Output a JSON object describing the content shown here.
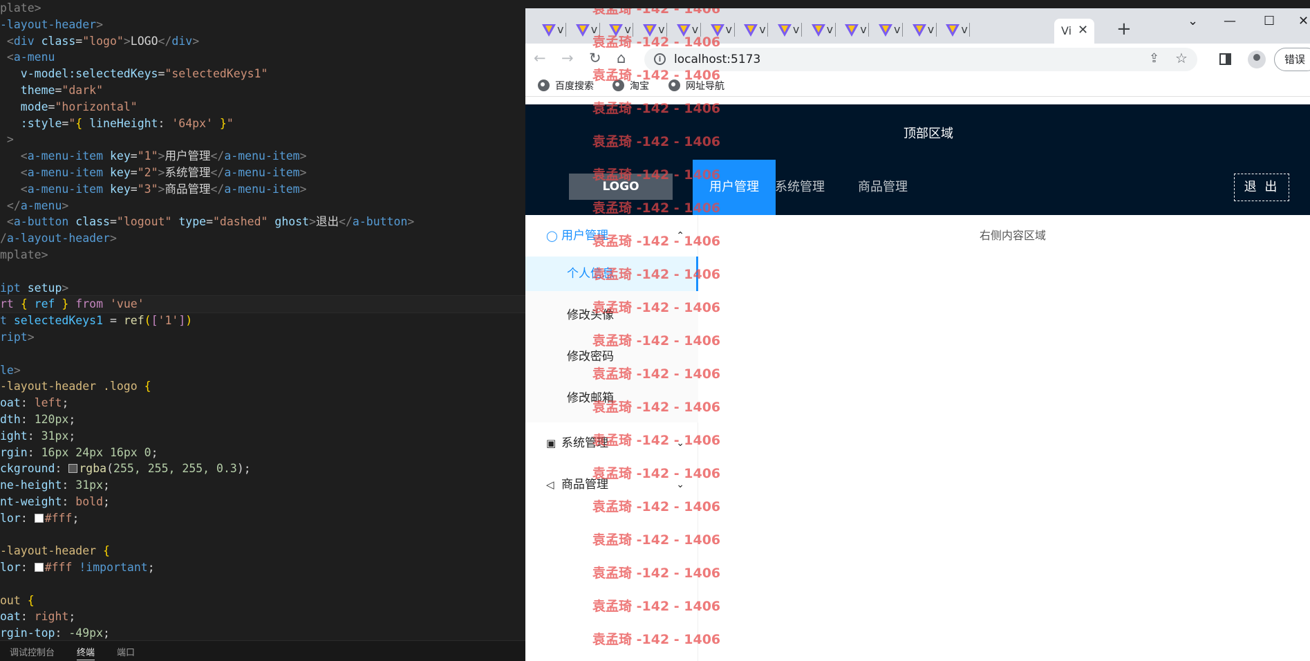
{
  "editor": {
    "lines": [
      [
        [
          "t-punc",
          "plate>"
        ]
      ],
      [
        [
          "t-tag",
          "-layout-header"
        ],
        [
          "t-punc",
          ">"
        ]
      ],
      [
        [
          "t-punc",
          " <"
        ],
        [
          "t-tag",
          "div"
        ],
        [
          "t-attr",
          " class"
        ],
        [
          "t-txt",
          "="
        ],
        [
          "t-str",
          "\"logo\""
        ],
        [
          "t-punc",
          ">"
        ],
        [
          "t-txt",
          "LOGO"
        ],
        [
          "t-punc",
          "</"
        ],
        [
          "t-tag",
          "div"
        ],
        [
          "t-punc",
          ">"
        ]
      ],
      [
        [
          "t-punc",
          " <"
        ],
        [
          "t-tag",
          "a-menu"
        ]
      ],
      [
        [
          "t-attr",
          "   v-model:selectedKeys"
        ],
        [
          "t-txt",
          "="
        ],
        [
          "t-str",
          "\"selectedKeys1\""
        ]
      ],
      [
        [
          "t-attr",
          "   theme"
        ],
        [
          "t-txt",
          "="
        ],
        [
          "t-str",
          "\"dark\""
        ]
      ],
      [
        [
          "t-attr",
          "   mode"
        ],
        [
          "t-txt",
          "="
        ],
        [
          "t-str",
          "\"horizontal\""
        ]
      ],
      [
        [
          "t-attr",
          "   :style"
        ],
        [
          "t-txt",
          "="
        ],
        [
          "t-str",
          "\""
        ],
        [
          "t-brk",
          "{"
        ],
        [
          "t-attr",
          " lineHeight"
        ],
        [
          "t-txt",
          ": "
        ],
        [
          "t-str",
          "'64px'"
        ],
        [
          "t-brk",
          " }"
        ],
        [
          "t-str",
          "\""
        ]
      ],
      [
        [
          "t-punc",
          " >"
        ]
      ],
      [
        [
          "t-punc",
          "   <"
        ],
        [
          "t-tag",
          "a-menu-item"
        ],
        [
          "t-attr",
          " key"
        ],
        [
          "t-txt",
          "="
        ],
        [
          "t-str",
          "\"1\""
        ],
        [
          "t-punc",
          ">"
        ],
        [
          "t-txt",
          "用户管理"
        ],
        [
          "t-punc",
          "</"
        ],
        [
          "t-tag",
          "a-menu-item"
        ],
        [
          "t-punc",
          ">"
        ]
      ],
      [
        [
          "t-punc",
          "   <"
        ],
        [
          "t-tag",
          "a-menu-item"
        ],
        [
          "t-attr",
          " key"
        ],
        [
          "t-txt",
          "="
        ],
        [
          "t-str",
          "\"2\""
        ],
        [
          "t-punc",
          ">"
        ],
        [
          "t-txt",
          "系统管理"
        ],
        [
          "t-punc",
          "</"
        ],
        [
          "t-tag",
          "a-menu-item"
        ],
        [
          "t-punc",
          ">"
        ]
      ],
      [
        [
          "t-punc",
          "   <"
        ],
        [
          "t-tag",
          "a-menu-item"
        ],
        [
          "t-attr",
          " key"
        ],
        [
          "t-txt",
          "="
        ],
        [
          "t-str",
          "\"3\""
        ],
        [
          "t-punc",
          ">"
        ],
        [
          "t-txt",
          "商品管理"
        ],
        [
          "t-punc",
          "</"
        ],
        [
          "t-tag",
          "a-menu-item"
        ],
        [
          "t-punc",
          ">"
        ]
      ],
      [
        [
          "t-punc",
          " </"
        ],
        [
          "t-tag",
          "a-menu"
        ],
        [
          "t-punc",
          ">"
        ]
      ],
      [
        [
          "t-punc",
          " <"
        ],
        [
          "t-tag",
          "a-button"
        ],
        [
          "t-attr",
          " class"
        ],
        [
          "t-txt",
          "="
        ],
        [
          "t-str",
          "\"logout\""
        ],
        [
          "t-attr",
          " type"
        ],
        [
          "t-txt",
          "="
        ],
        [
          "t-str",
          "\"dashed\""
        ],
        [
          "t-attr",
          " ghost"
        ],
        [
          "t-punc",
          ">"
        ],
        [
          "t-txt",
          "退出"
        ],
        [
          "t-punc",
          "</"
        ],
        [
          "t-tag",
          "a-button"
        ],
        [
          "t-punc",
          ">"
        ]
      ],
      [
        [
          "t-punc",
          "/"
        ],
        [
          "t-tag",
          "a-layout-header"
        ],
        [
          "t-punc",
          ">"
        ]
      ],
      [
        [
          "t-punc",
          "mplate>"
        ]
      ],
      [],
      [
        [
          "t-tag",
          "ipt"
        ],
        [
          "t-attr",
          " setup"
        ],
        [
          "t-punc",
          ">"
        ]
      ],
      [
        [
          "t-kw",
          "rt"
        ],
        [
          "t-txt",
          " "
        ],
        [
          "t-brk",
          "{"
        ],
        [
          "t-var",
          " ref "
        ],
        [
          "t-brk",
          "}"
        ],
        [
          "t-kw",
          " from"
        ],
        [
          "t-str",
          " 'vue'"
        ]
      ],
      [
        [
          "t-tag",
          "t"
        ],
        [
          "t-var",
          " selectedKeys1"
        ],
        [
          "t-txt",
          " = "
        ],
        [
          "t-fn",
          "ref"
        ],
        [
          "t-brk",
          "("
        ],
        [
          "t-kw",
          "["
        ],
        [
          "t-str",
          "'1'"
        ],
        [
          "t-kw",
          "]"
        ],
        [
          "t-brk",
          ")"
        ]
      ],
      [
        [
          "t-tag",
          "ript"
        ],
        [
          "t-punc",
          ">"
        ]
      ],
      [],
      [
        [
          "t-tag",
          "le"
        ],
        [
          "t-punc",
          ">"
        ]
      ],
      [
        [
          "t-sel",
          "-layout-header .logo "
        ],
        [
          "t-brk",
          "{"
        ]
      ],
      [
        [
          "t-prop",
          "oat"
        ],
        [
          "t-txt",
          ": "
        ],
        [
          "t-val",
          "left"
        ],
        [
          "t-txt",
          ";"
        ]
      ],
      [
        [
          "t-prop",
          "dth"
        ],
        [
          "t-txt",
          ": "
        ],
        [
          "t-num",
          "120px"
        ],
        [
          "t-txt",
          ";"
        ]
      ],
      [
        [
          "t-prop",
          "ight"
        ],
        [
          "t-txt",
          ": "
        ],
        [
          "t-num",
          "31px"
        ],
        [
          "t-txt",
          ";"
        ]
      ],
      [
        [
          "t-prop",
          "rgin"
        ],
        [
          "t-txt",
          ": "
        ],
        [
          "t-num",
          "16px 24px 16px 0"
        ],
        [
          "t-txt",
          ";"
        ]
      ],
      [
        [
          "t-prop",
          "ckground"
        ],
        [
          "t-txt",
          ": "
        ],
        [
          "swatch",
          "#555"
        ],
        [
          "t-fn",
          "rgba"
        ],
        [
          "t-txt",
          "("
        ],
        [
          "t-num",
          "255, 255, 255, 0.3"
        ],
        [
          "t-txt",
          ");"
        ]
      ],
      [
        [
          "t-prop",
          "ne-height"
        ],
        [
          "t-txt",
          ": "
        ],
        [
          "t-num",
          "31px"
        ],
        [
          "t-txt",
          ";"
        ]
      ],
      [
        [
          "t-prop",
          "nt-weight"
        ],
        [
          "t-txt",
          ": "
        ],
        [
          "t-val",
          "bold"
        ],
        [
          "t-txt",
          ";"
        ]
      ],
      [
        [
          "t-prop",
          "lor"
        ],
        [
          "t-txt",
          ": "
        ],
        [
          "swatch",
          "#fff"
        ],
        [
          "t-val",
          "#fff"
        ],
        [
          "t-txt",
          ";"
        ]
      ],
      [],
      [
        [
          "t-sel",
          "-layout-header "
        ],
        [
          "t-brk",
          "{"
        ]
      ],
      [
        [
          "t-prop",
          "lor"
        ],
        [
          "t-txt",
          ": "
        ],
        [
          "swatch",
          "#fff"
        ],
        [
          "t-val",
          "#fff"
        ],
        [
          "t-tag",
          " !important"
        ],
        [
          "t-txt",
          ";"
        ]
      ],
      [],
      [
        [
          "t-sel",
          "out "
        ],
        [
          "t-brk",
          "{"
        ]
      ],
      [
        [
          "t-prop",
          "oat"
        ],
        [
          "t-txt",
          ": "
        ],
        [
          "t-val",
          "right"
        ],
        [
          "t-txt",
          ";"
        ]
      ],
      [
        [
          "t-prop",
          "rgin-top"
        ],
        [
          "t-txt",
          ": "
        ],
        [
          "t-num",
          "-49px"
        ],
        [
          "t-txt",
          ";"
        ]
      ]
    ],
    "highlighted_line": 18,
    "panel_tabs": [
      "调试控制台",
      "终端",
      "端口"
    ]
  },
  "browser": {
    "tab_title_short": "v",
    "active_tab_title": "Vi",
    "tab_count": 13,
    "new_tab_symbol": "+",
    "window_controls": [
      "⌄",
      "—",
      "☐",
      "✕"
    ],
    "nav": {
      "back": "←",
      "forward": "→",
      "reload": "↻",
      "home": "⌂"
    },
    "url": "localhost:5173",
    "error_button": "错误",
    "bookmarks": [
      "百度搜索",
      "淘宝",
      "网址导航"
    ]
  },
  "page": {
    "top_header_text": "顶部区域",
    "logo_text": "LOGO",
    "menu_items": [
      "用户管理",
      "系统管理",
      "商品管理"
    ],
    "logout_label": "退 出",
    "sider": {
      "groups": [
        {
          "label": "用户管理",
          "icon": "user-icon",
          "expanded": true
        },
        {
          "label": "系统管理",
          "icon": "laptop-icon",
          "expanded": false
        },
        {
          "label": "商品管理",
          "icon": "notification-icon",
          "expanded": false
        }
      ],
      "sub_items": [
        "个人信息",
        "修改头像",
        "修改密码",
        "修改邮箱"
      ]
    },
    "content_text": "右侧内容区域"
  },
  "watermark_text": "袁孟琦 -142 - 1406",
  "colors": {
    "header_bg": "#001529",
    "primary": "#1890ff",
    "selected_sub_bg": "#e6f7ff",
    "watermark": "#e84646"
  }
}
